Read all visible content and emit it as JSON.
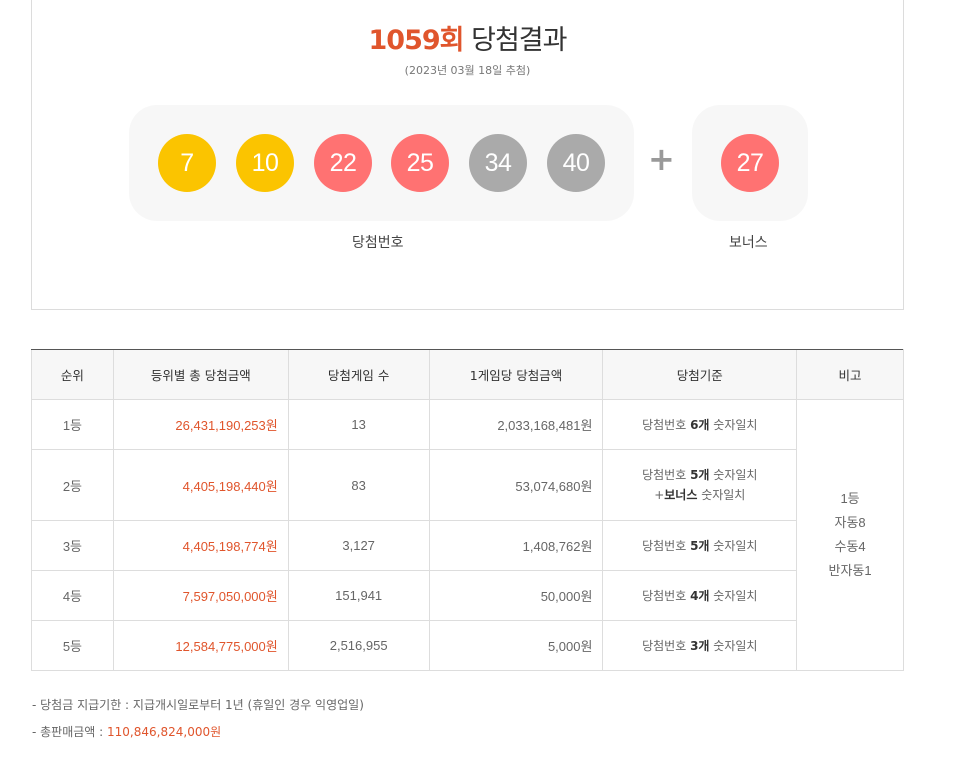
{
  "header": {
    "round": "1059회",
    "title": "당첨결과",
    "draw_date": "(2023년 03월 18일 추첨)"
  },
  "winning_numbers": [
    {
      "number": "7",
      "color": "#fbc400"
    },
    {
      "number": "10",
      "color": "#fbc400"
    },
    {
      "number": "22",
      "color": "#ff7272"
    },
    {
      "number": "25",
      "color": "#ff7272"
    },
    {
      "number": "34",
      "color": "#aaaaaa"
    },
    {
      "number": "40",
      "color": "#aaaaaa"
    }
  ],
  "plus_sign": "+",
  "bonus": {
    "number": "27",
    "color": "#ff7272"
  },
  "labels": {
    "winning": "당첨번호",
    "bonus": "보너스"
  },
  "table": {
    "headers": [
      "순위",
      "등위별 총 당첨금액",
      "당첨게임 수",
      "1게임당 당첨금액",
      "당첨기준",
      "비고"
    ],
    "rows": [
      {
        "rank": "1등",
        "total": "26,431,190,253원",
        "count": "13",
        "each": "2,033,168,481원",
        "crit_pre": "당첨번호 ",
        "crit_bold": "6개",
        "crit_post": " 숫자일치",
        "crit2_pre": "",
        "crit2_bold": "",
        "crit2_post": ""
      },
      {
        "rank": "2등",
        "total": "4,405,198,440원",
        "count": "83",
        "each": "53,074,680원",
        "crit_pre": "당첨번호 ",
        "crit_bold": "5개",
        "crit_post": " 숫자일치",
        "crit2_pre": "+",
        "crit2_bold": "보너스",
        "crit2_post": " 숫자일치"
      },
      {
        "rank": "3등",
        "total": "4,405,198,774원",
        "count": "3,127",
        "each": "1,408,762원",
        "crit_pre": "당첨번호 ",
        "crit_bold": "5개",
        "crit_post": " 숫자일치",
        "crit2_pre": "",
        "crit2_bold": "",
        "crit2_post": ""
      },
      {
        "rank": "4등",
        "total": "7,597,050,000원",
        "count": "151,941",
        "each": "50,000원",
        "crit_pre": "당첨번호 ",
        "crit_bold": "4개",
        "crit_post": " 숫자일치",
        "crit2_pre": "",
        "crit2_bold": "",
        "crit2_post": ""
      },
      {
        "rank": "5등",
        "total": "12,584,775,000원",
        "count": "2,516,955",
        "each": "5,000원",
        "crit_pre": "당첨번호 ",
        "crit_bold": "3개",
        "crit_post": " 숫자일치",
        "crit2_pre": "",
        "crit2_bold": "",
        "crit2_post": ""
      }
    ],
    "note": [
      "1등",
      "자동8",
      "수동4",
      "반자동1"
    ]
  },
  "footnotes": {
    "deadline_label": "-  당첨금 지급기한 : 지급개시일로부터 1년 (휴일인 경우 익영업일)",
    "sales_label": "-  총판매금액 : ",
    "sales_value": "110,846,824,000원"
  }
}
